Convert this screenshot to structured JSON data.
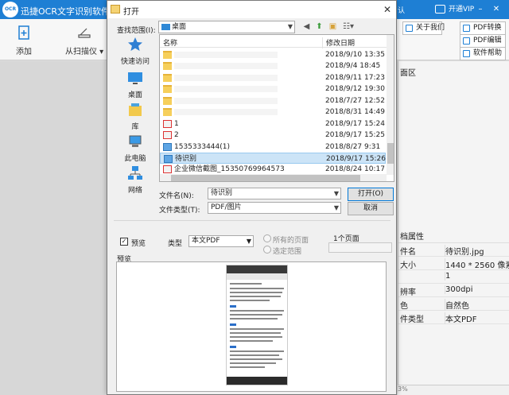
{
  "app": {
    "title": "迅捷OCR文字识别软件V",
    "logo_text": "OCR",
    "login": "认",
    "vip": "开通VIP",
    "toolbar": {
      "add": "添加",
      "scan": "从扫描仪",
      "about": "关于我们",
      "pdf_convert": "PDF转换",
      "pdf_edit": "PDF编辑",
      "help": "软件帮助"
    },
    "right_panel": {
      "header": "面区",
      "attr_header": "档属性",
      "attributes": [
        {
          "key": "件名",
          "value": "待识别.jpg"
        },
        {
          "key": "大小",
          "value": "1440 * 2560 像素"
        },
        {
          "key": "",
          "value": "1"
        },
        {
          "key": "辨率",
          "value": "300dpi"
        },
        {
          "key": "色",
          "value": "自然色"
        },
        {
          "key": "件类型",
          "value": "本文PDF"
        }
      ],
      "status": "3%"
    }
  },
  "dialog": {
    "title": "打开",
    "close": "✕",
    "look_in_label": "查找范围(I):",
    "look_in_value": "桌面",
    "places": [
      {
        "label": "快速访问",
        "icon": "star-icon"
      },
      {
        "label": "桌面",
        "icon": "desktop-icon"
      },
      {
        "label": "库",
        "icon": "library-icon"
      },
      {
        "label": "此电脑",
        "icon": "computer-icon"
      },
      {
        "label": "网络",
        "icon": "network-icon"
      }
    ],
    "columns": {
      "name": "名称",
      "date": "修改日期"
    },
    "files": [
      {
        "name": "",
        "date": "2018/9/10 13:35",
        "type": "folder"
      },
      {
        "name": "",
        "date": "2018/9/4 18:45",
        "type": "folder"
      },
      {
        "name": "",
        "date": "2018/9/11 17:23",
        "type": "folder"
      },
      {
        "name": "",
        "date": "2018/9/12 19:30",
        "type": "folder"
      },
      {
        "name": "",
        "date": "2018/7/27 12:52",
        "type": "folder"
      },
      {
        "name": "",
        "date": "2018/8/31 14:49",
        "type": "folder"
      },
      {
        "name": "1",
        "date": "2018/9/17 15:24",
        "type": "pdf"
      },
      {
        "name": "2",
        "date": "2018/9/17 15:25",
        "type": "pdf"
      },
      {
        "name": "1535333444(1)",
        "date": "2018/8/27 9:31",
        "type": "img"
      },
      {
        "name": "待识别",
        "date": "2018/9/17 15:26",
        "type": "img"
      },
      {
        "name": "企业微信截图_15350769964573",
        "date": "2018/8/24 10:17",
        "type": "pdf"
      }
    ],
    "filename_label": "文件名(N):",
    "filename_value": "待识别",
    "filetype_label": "文件类型(T):",
    "filetype_value": "PDF/图片",
    "open_button": "打开(O)",
    "cancel_button": "取消",
    "preview_label": "预览",
    "preview_checked": "✓",
    "type_label": "类型",
    "type_value": "本文PDF",
    "all_pages": "所有的页面",
    "selected_range": "选定范围",
    "page_count": "1个页面",
    "preview_area_label": "预览"
  }
}
